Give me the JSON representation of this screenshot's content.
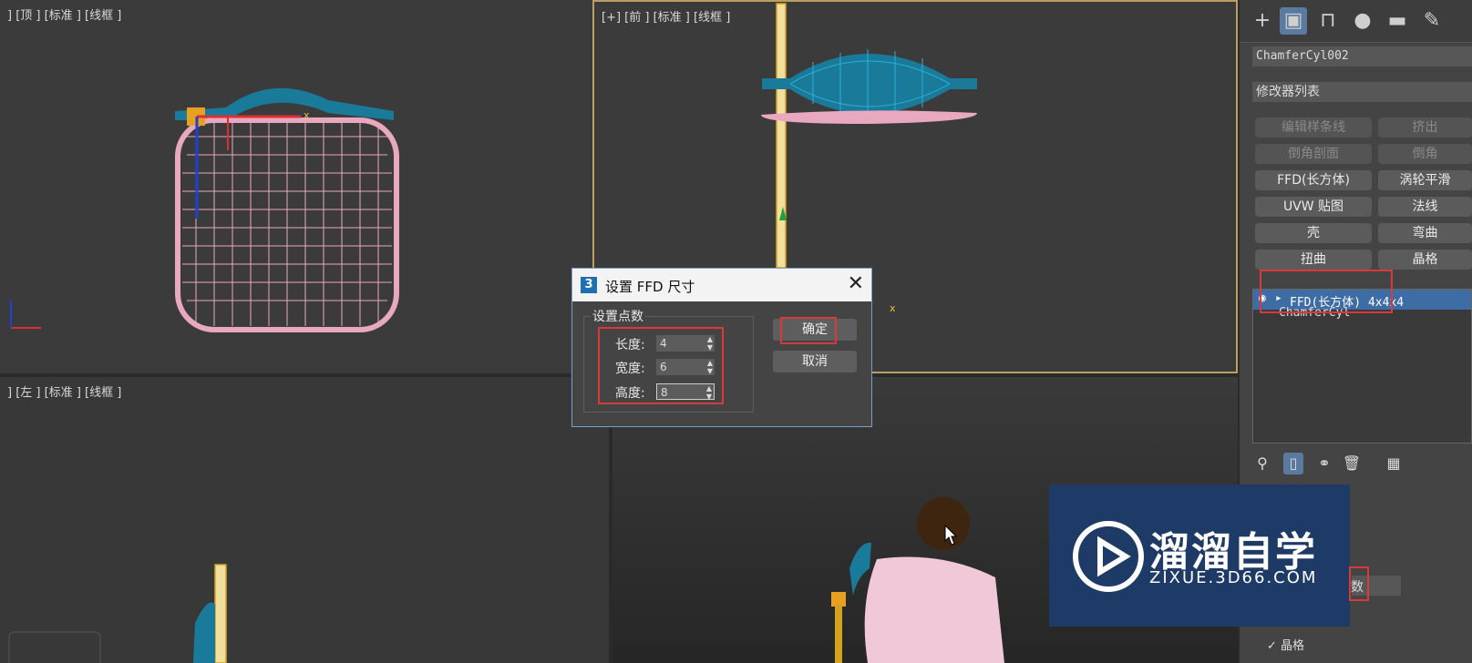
{
  "viewports": {
    "top_label": "] [顶 ] [标准 ] [线框 ]",
    "front_label": "[+] [前 ] [标准 ] [线框 ]",
    "left_label": "] [左 ] [标准 ] [线框 ]"
  },
  "command_panel": {
    "tabs": [
      "create-icon",
      "modify-icon",
      "hierarchy-icon",
      "motion-icon",
      "display-icon",
      "utilities-icon"
    ],
    "object_name": "ChamferCyl002",
    "modifier_list": "修改器列表",
    "modifier_buttons": [
      {
        "label": "编辑样条线",
        "enabled": false
      },
      {
        "label": "挤出",
        "enabled": false
      },
      {
        "label": "倒角剖面",
        "enabled": false
      },
      {
        "label": "倒角",
        "enabled": false
      },
      {
        "label": "FFD(长方体)",
        "enabled": true
      },
      {
        "label": "涡轮平滑",
        "enabled": true
      },
      {
        "label": "UVW 贴图",
        "enabled": true
      },
      {
        "label": "法线",
        "enabled": true
      },
      {
        "label": "壳",
        "enabled": true
      },
      {
        "label": "弯曲",
        "enabled": true
      },
      {
        "label": "扭曲",
        "enabled": true
      },
      {
        "label": "晶格",
        "enabled": true
      }
    ],
    "stack": [
      "FFD(长方体) 4x4x4",
      "ChamferCyl"
    ],
    "partial_label": "数",
    "bottom_label": "✓ 晶格"
  },
  "dialog": {
    "title": "设置 FFD 尺寸",
    "group_label": "设置点数",
    "length_label": "长度:",
    "length_value": "4",
    "width_label": "宽度:",
    "width_value": "6",
    "height_label": "高度:",
    "height_value": "8",
    "ok_label": "确定",
    "cancel_label": "取消",
    "close_glyph": "✕"
  },
  "watermark": {
    "title": "溜溜自学",
    "subtitle": "ZIXUE.3D66.COM"
  },
  "colors": {
    "pink": "#e8a8c0",
    "teal": "#1a7a9a",
    "highlight": "#d63a3a",
    "selection": "#3e6da6"
  }
}
